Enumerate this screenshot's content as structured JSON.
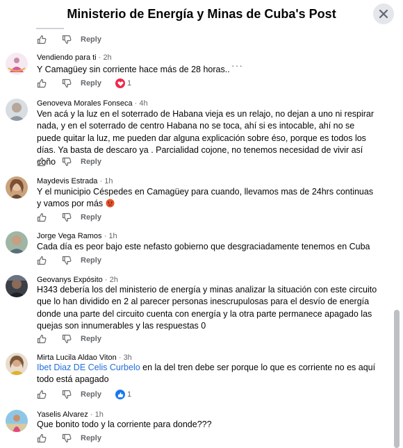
{
  "header": {
    "title": "Ministerio de Energía y Minas de Cuba's Post"
  },
  "icons": {
    "close": "close-icon",
    "like": "thumbs-up-icon",
    "dislike": "thumbs-down-icon",
    "more": "more-icon"
  },
  "colors": {
    "link": "#216fdb",
    "meta": "#65676b",
    "love": "#f0284a",
    "like": "#1877f2",
    "angry": "#e8542c"
  },
  "top_actions": {
    "reply_label": "Reply"
  },
  "comments": [
    {
      "name": "Vendiendo para ti",
      "dot": "·",
      "time": "2h",
      "text": "Y Camagüey sin corriente hace más de 28 horas..",
      "more": "···",
      "reply_label": "Reply",
      "reaction_count": "1",
      "reaction_icon": "love-reaction-icon"
    },
    {
      "name": "Genoveva Morales Fonseca",
      "dot": "·",
      "time": "4h",
      "text": "Ven acá y la luz en el soterrado de Habana vieja es un relajo, no dejan a uno ni respirar nada, y en el soterrado de centro Habana no se toca, ahí si es intocable, ahí no se puede quitar la luz, me pueden dar alguna explicación sobre éso, porque es todos los días. Ya basta de descaro ya . Parcialidad cojone, no tenemos necesidad de vivir así coño",
      "reply_label": "Reply"
    },
    {
      "name": "Maydevis Estrada",
      "dot": "·",
      "time": "1h",
      "text": "Y el municipio Céspedes en Camagüey para cuando, llevamos mas de 24hrs continuas y vamos por más",
      "emoji": "angry-face-icon",
      "reply_label": "Reply"
    },
    {
      "name": "Jorge Vega Ramos",
      "dot": "·",
      "time": "1h",
      "text": "Cada día es peor bajo este nefasto gobierno que desgraciadamente tenemos en Cuba",
      "reply_label": "Reply"
    },
    {
      "name": "Geovanys Expósito",
      "dot": "·",
      "time": "2h",
      "text": "H343 debería los del ministerio de energía y minas analizar la situación con este circuito que lo han dividido en 2 al parecer personas inescrupulosas para el desvío de energía donde una parte del circuito cuenta con energía y la otra parte permanece apagado las quejas son innumerables y las respuestas 0",
      "reply_label": "Reply"
    },
    {
      "name": "Mirta Lucila Aldao Viton",
      "dot": "·",
      "time": "3h",
      "mention": "Ibet Diaz DE Celis Curbelo",
      "text": " en la del tren debe ser porque lo que es corriente no es aquí todo está apagado",
      "reply_label": "Reply",
      "reaction_count": "1",
      "reaction_icon": "like-reaction-icon"
    },
    {
      "name": "Yaselis Alvarez",
      "dot": "·",
      "time": "1h",
      "text": "Que bonito todo y la corriente para donde???",
      "reply_label": "Reply"
    }
  ]
}
